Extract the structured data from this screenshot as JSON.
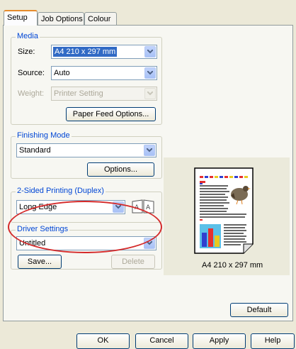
{
  "tabs": [
    {
      "label": "Setup"
    },
    {
      "label": "Job Options"
    },
    {
      "label": "Colour"
    }
  ],
  "media": {
    "legend": "Media",
    "size_label": "Size:",
    "size_value": "A4 210 x 297 mm",
    "source_label": "Source:",
    "source_value": "Auto",
    "weight_label": "Weight:",
    "weight_value": "Printer Setting",
    "paper_feed_button": "Paper Feed Options..."
  },
  "finishing": {
    "legend": "Finishing Mode",
    "value": "Standard",
    "options_button": "Options..."
  },
  "duplex": {
    "legend": "2-Sided Printing (Duplex)",
    "value": "Long Edge"
  },
  "driver": {
    "legend": "Driver Settings",
    "value": "Untitled",
    "save_button": "Save...",
    "delete_button": "Delete"
  },
  "preview": {
    "caption": "A4 210 x 297 mm"
  },
  "default_button": "Default",
  "footer": {
    "ok": "OK",
    "cancel": "Cancel",
    "apply": "Apply",
    "help": "Help"
  },
  "colors": {
    "highlight_oval": "#d42a2a",
    "legend_text": "#0046d5",
    "selection": "#316ac5"
  },
  "icons": [
    "chevron-down-icon",
    "duplex-book-icon",
    "page-preview-icon"
  ]
}
